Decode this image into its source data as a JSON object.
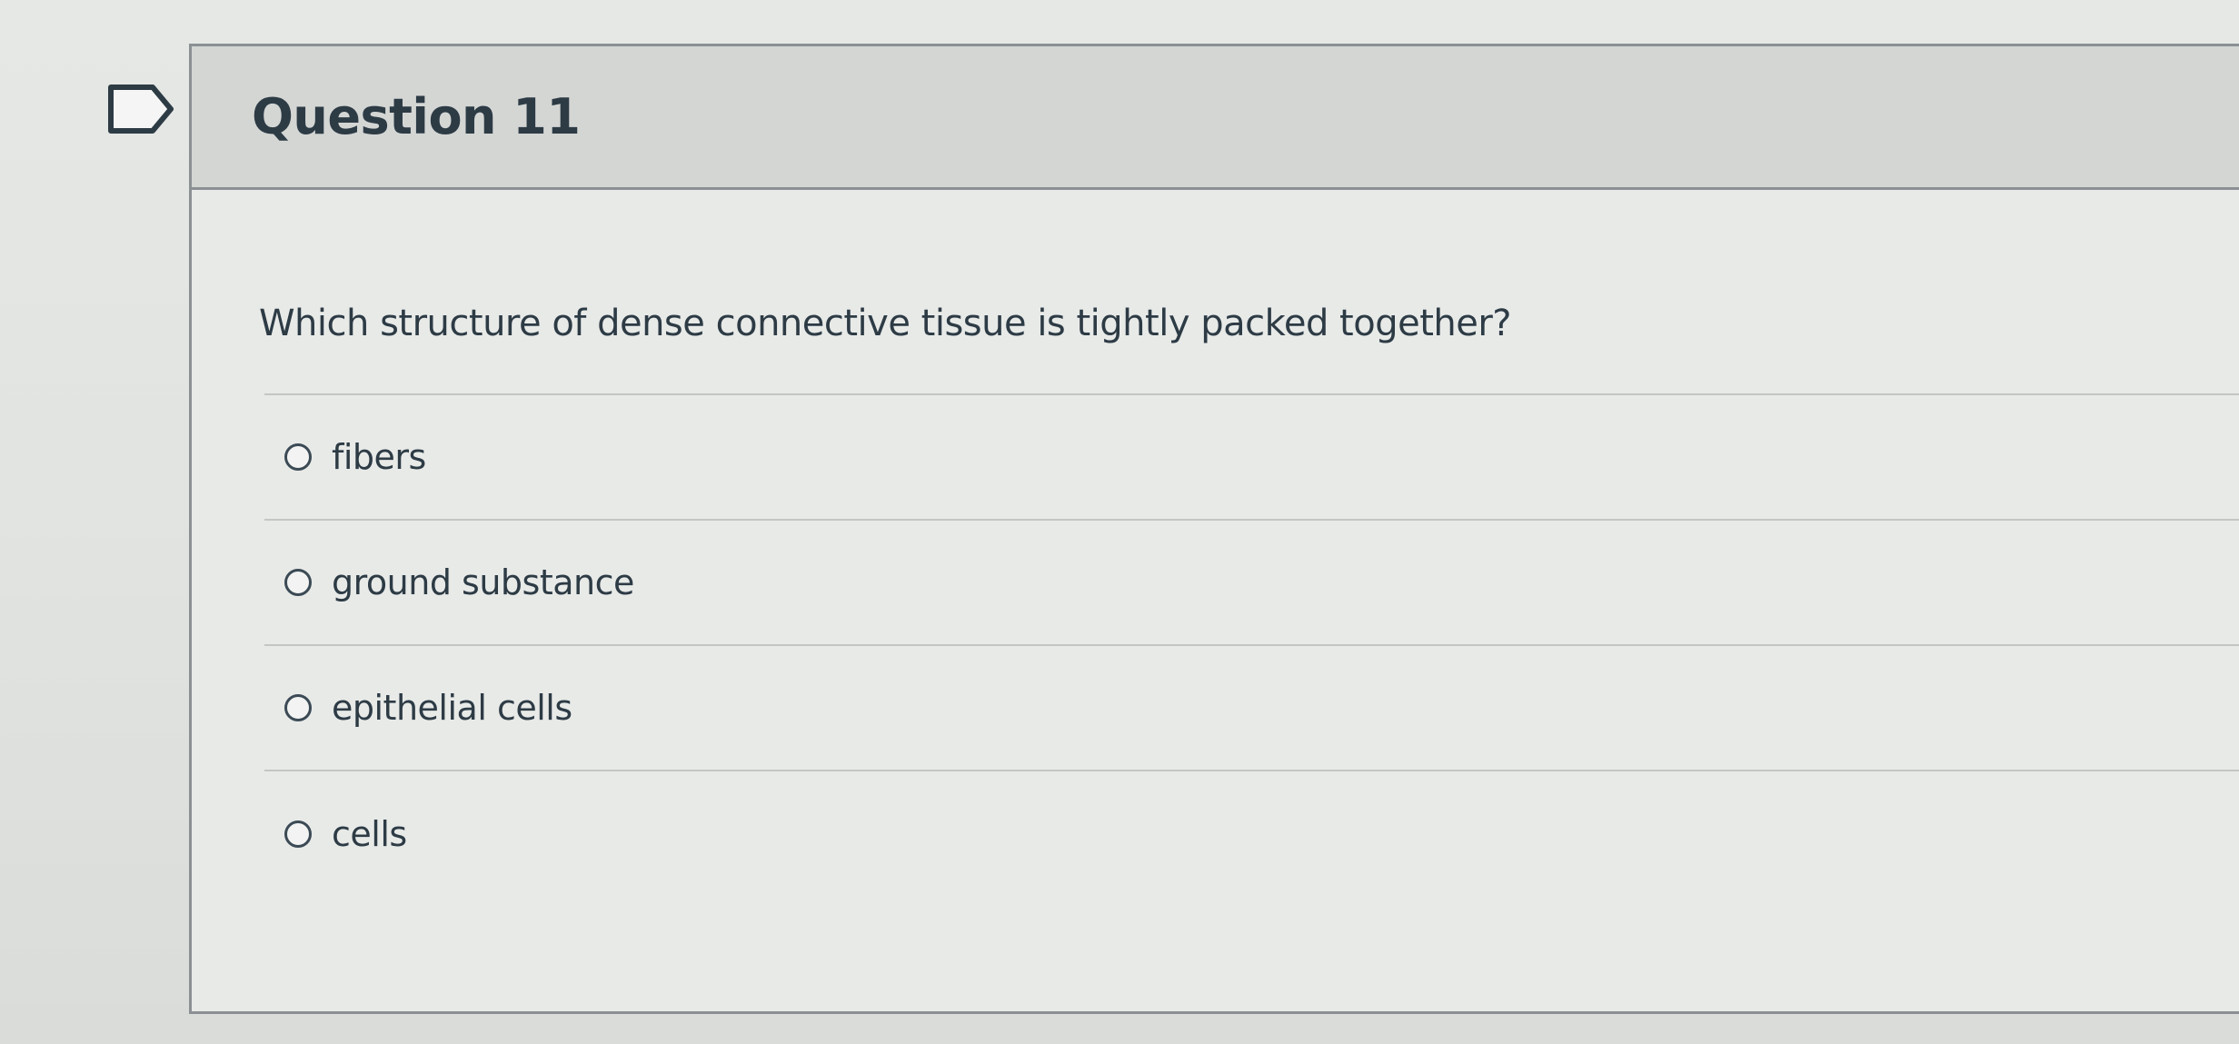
{
  "question": {
    "title": "Question 11",
    "text": "Which structure of dense connective tissue is tightly packed together?",
    "answers": [
      {
        "label": "fibers",
        "selected": false
      },
      {
        "label": "ground substance",
        "selected": false
      },
      {
        "label": "epithelial cells",
        "selected": false
      },
      {
        "label": "cells",
        "selected": false
      }
    ]
  },
  "icons": {
    "flag": "flag-icon",
    "radio": "radio-button-icon"
  },
  "colors": {
    "text": "#2d3b45",
    "header_background": "#d4d6d4",
    "border": "#8b9094"
  }
}
